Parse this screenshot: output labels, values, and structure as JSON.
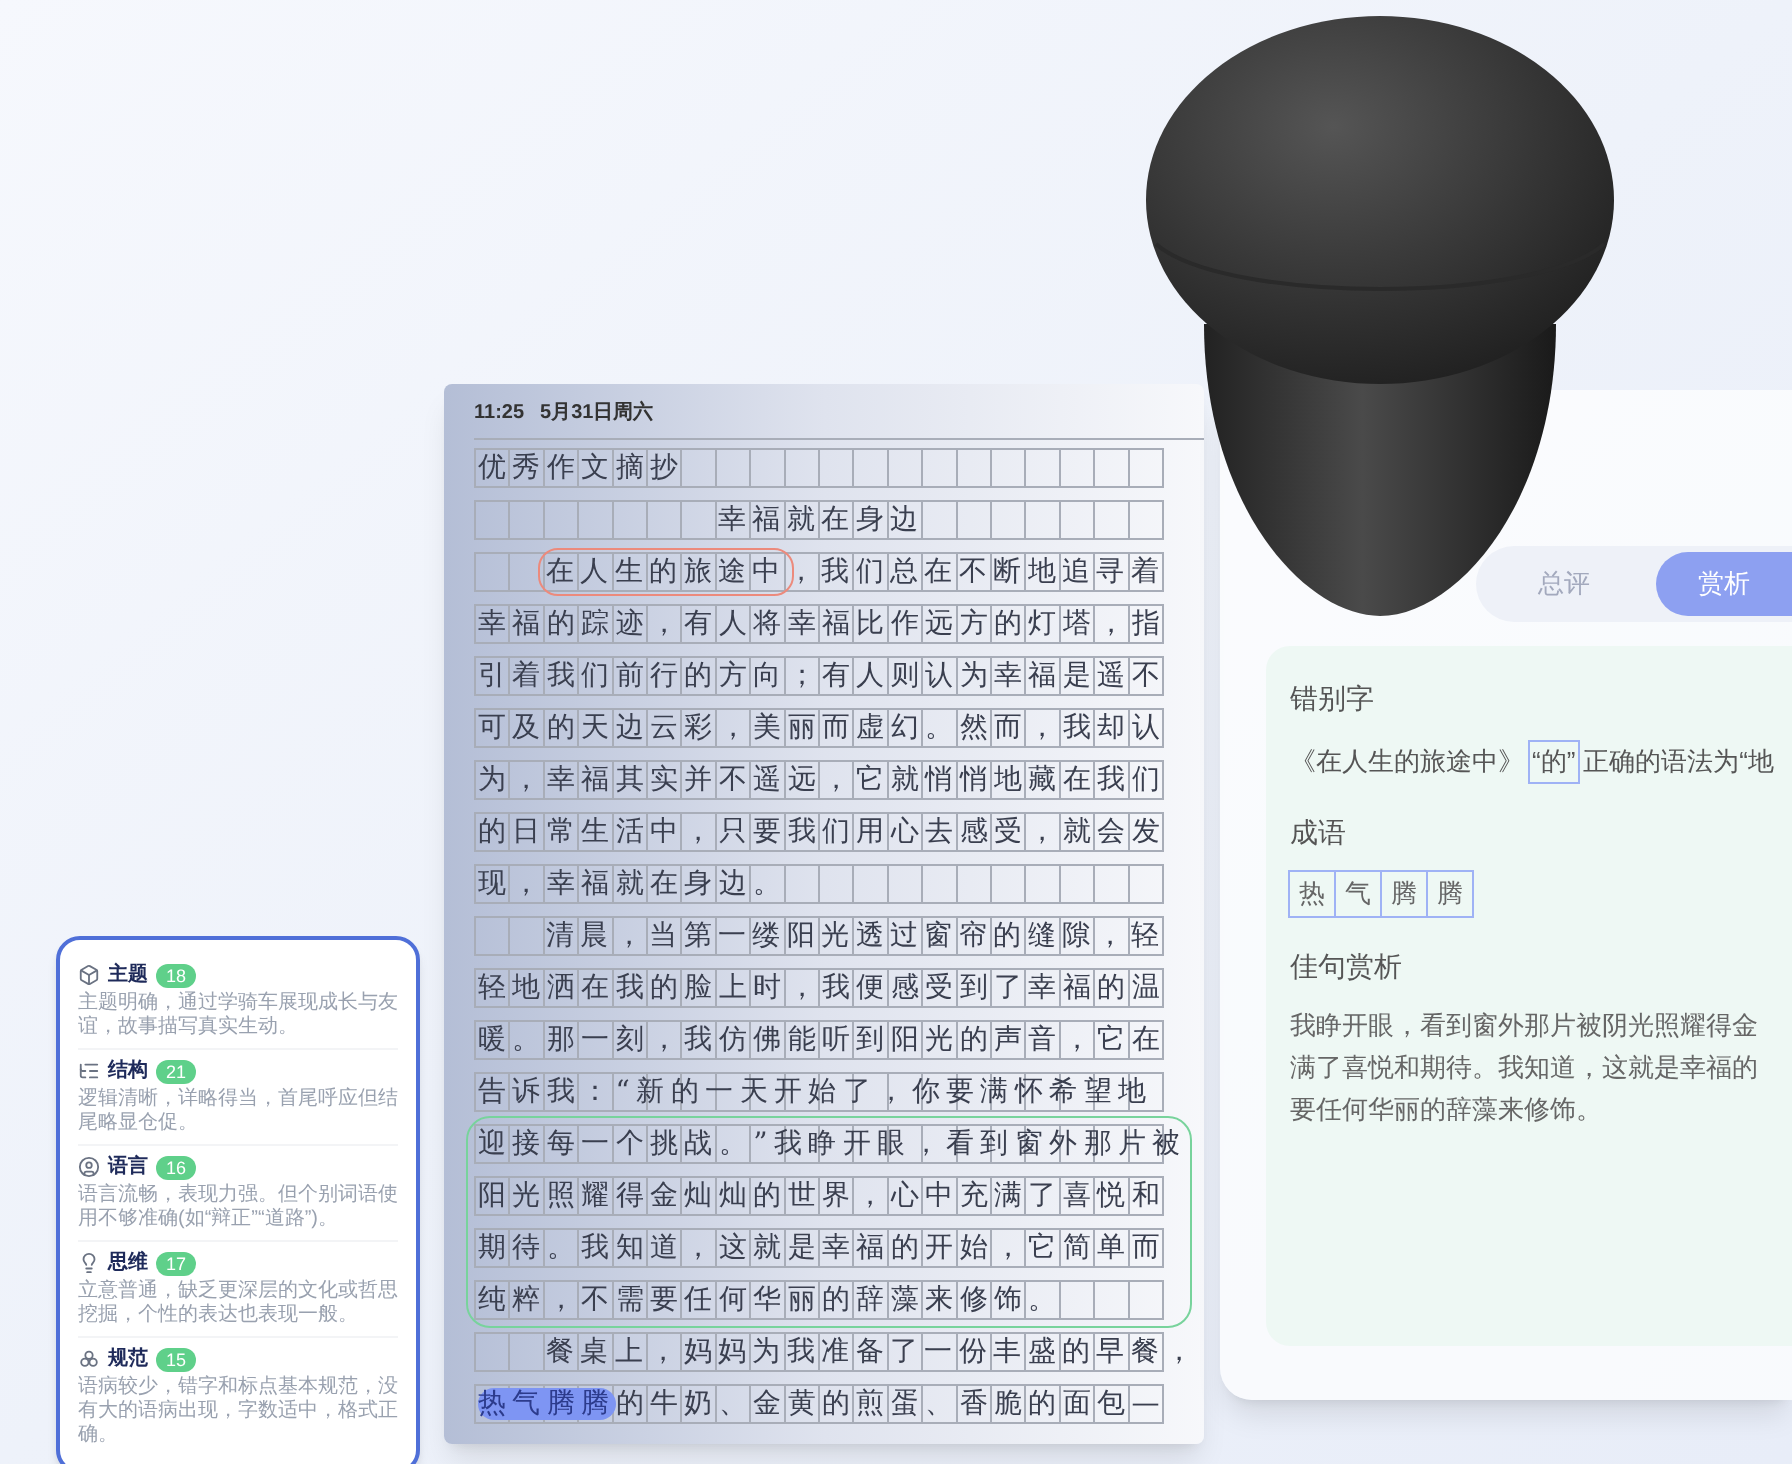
{
  "score_card": {
    "items": [
      {
        "title": "主题",
        "score": "18",
        "text": "主题明确，通过学骑车展现成长与友谊，故事描写真实生动。"
      },
      {
        "title": "结构",
        "score": "21",
        "text": "逻辑清晰，详略得当，首尾呼应但结尾略显仓促。"
      },
      {
        "title": "语言",
        "score": "16",
        "text": "语言流畅，表现力强。但个别词语使用不够准确(如“辩正”“道路”)。"
      },
      {
        "title": "思维",
        "score": "17",
        "text": "立意普通，缺乏更深层的文化或哲思挖掘，个性的表达也表现一般。"
      },
      {
        "title": "规范",
        "score": "15",
        "text": "语病较少，错字和标点基本规范，没有大的语病出现，字数适中，格式正确。"
      }
    ]
  },
  "tablet": {
    "status_time": "11:25",
    "status_date": "5月31日周六",
    "lines": [
      {
        "kind": "heading",
        "parts": [
          {
            "text": "优秀作文摘抄"
          }
        ]
      },
      {
        "kind": "title",
        "parts": [
          {
            "text": "幸福就在身边"
          }
        ]
      },
      {
        "kind": "line",
        "indent": true,
        "parts": [
          {
            "text": "在人生的旅途中",
            "kind": "error"
          },
          {
            "text": "，我们总在不断地追寻着"
          }
        ]
      },
      {
        "kind": "line",
        "parts": [
          {
            "text": "幸福的踪迹，有人将幸福比作远方的灯塔，指"
          }
        ]
      },
      {
        "kind": "line",
        "parts": [
          {
            "text": "引着我们前行的方向；有人则认为幸福是遥不"
          }
        ]
      },
      {
        "kind": "line",
        "parts": [
          {
            "text": "可及的天边云彩，美丽而虚幻。然而，我却认"
          }
        ]
      },
      {
        "kind": "line",
        "parts": [
          {
            "text": "为，幸福其实并不遥远，它就悄悄地藏在我们"
          }
        ]
      },
      {
        "kind": "line",
        "parts": [
          {
            "text": "的日常生活中，只要我们用心去感受，就会发"
          }
        ]
      },
      {
        "kind": "line",
        "parts": [
          {
            "text": "现，幸福就在身边。"
          }
        ]
      },
      {
        "kind": "line",
        "indent": true,
        "parts": [
          {
            "text": "清晨，当第一缕阳光透过窗帘的缝隙，轻"
          }
        ]
      },
      {
        "kind": "line",
        "parts": [
          {
            "text": "轻地洒在我的脸上时，我便感受到了幸福的温"
          }
        ]
      },
      {
        "kind": "line",
        "parts": [
          {
            "text": "暖。那一刻，我仿佛能听到阳光的声音，它在"
          }
        ]
      },
      {
        "kind": "line",
        "parts": [
          {
            "text": "告诉我：“新的一天开始了，你要满怀希望地"
          }
        ]
      },
      {
        "kind": "excerpt",
        "lines": [
          {
            "parts": [
              {
                "text": "迎接每一个挑战。”我睁开眼，看到窗外那片被"
              }
            ]
          },
          {
            "parts": [
              {
                "text": "阳光照耀得金灿灿的世界，心中充满了喜悦和"
              }
            ]
          },
          {
            "parts": [
              {
                "text": "期待。我知道，这就是幸福的开始，它简单而"
              }
            ]
          },
          {
            "parts": [
              {
                "text": "纯粹，不需要任何华丽的辞藻来修饰。"
              }
            ]
          }
        ]
      },
      {
        "kind": "line",
        "indent": true,
        "parts": [
          {
            "text": "餐桌上，妈妈为我准备了一份丰盛的早餐，"
          }
        ]
      },
      {
        "kind": "line",
        "parts": [
          {
            "text": "热气腾腾",
            "kind": "idiom"
          },
          {
            "text": "的牛奶、金黄的煎蛋、香脆的面包—"
          }
        ]
      }
    ]
  },
  "review_panel": {
    "tabs": [
      {
        "label": "总评",
        "selected": false
      },
      {
        "label": "赏析",
        "selected": true
      }
    ],
    "typo": {
      "heading": "错别字",
      "parts": [
        {
          "text": "《在人生的旅途中》"
        },
        {
          "text": "“的”",
          "kind": "boxed"
        },
        {
          "text": "正确的语法为“地"
        }
      ]
    },
    "idiom": {
      "heading": "成语",
      "chars": [
        "热",
        "气",
        "腾",
        "腾"
      ]
    },
    "sentence": {
      "heading": "佳句赏析",
      "lines": [
        "我睁开眼，看到窗外那片被阴光照耀得金",
        "满了喜悦和期待。我知道，这就是幸福的",
        "要任何华丽的辞藻来修饰。"
      ]
    }
  }
}
